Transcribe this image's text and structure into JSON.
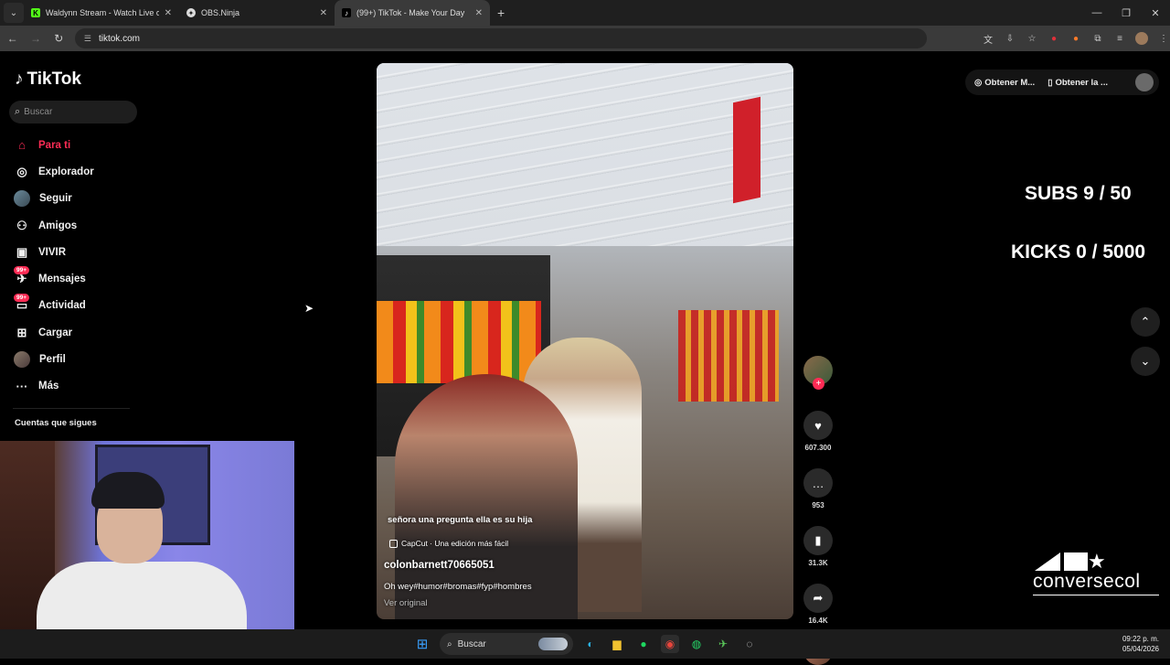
{
  "browser": {
    "tabs": [
      {
        "label": "Waldynn Stream - Watch Live o",
        "icon": "kick-icon",
        "active": false
      },
      {
        "label": "OBS.Ninja",
        "icon": "obs-ninja-icon",
        "active": false
      },
      {
        "label": "(99+) TikTok - Make Your Day",
        "icon": "tiktok-icon",
        "active": true
      }
    ],
    "url": "tiktok.com"
  },
  "sidebar": {
    "logo": "TikTok",
    "search_placeholder": "Buscar",
    "items": [
      {
        "label": "Para ti",
        "icon": "home-icon",
        "active": true
      },
      {
        "label": "Explorador",
        "icon": "compass-icon"
      },
      {
        "label": "Seguir",
        "icon": "avatar-icon"
      },
      {
        "label": "Amigos",
        "icon": "friends-icon"
      },
      {
        "label": "VIVIR",
        "icon": "live-icon"
      },
      {
        "label": "Mensajes",
        "icon": "messages-icon",
        "badge": "99+"
      },
      {
        "label": "Actividad",
        "icon": "activity-icon",
        "badge": "99+"
      },
      {
        "label": "Cargar",
        "icon": "upload-icon"
      },
      {
        "label": "Perfil",
        "icon": "profile-icon"
      },
      {
        "label": "Más",
        "icon": "more-icon"
      }
    ],
    "following_title": "Cuentas que sigues"
  },
  "video": {
    "caption": "señora una pregunta ella es su hija",
    "capcut_label": "CapCut · Una edición más fácil",
    "author": "colonbarnett70665051",
    "description": "Oh wey#humor#bromas#fyp#hombres",
    "see_original": "Ver original"
  },
  "actions": {
    "likes": "607.300",
    "comments": "953",
    "saves": "31.3K",
    "shares": "16.4K"
  },
  "header_right": {
    "get_coins": "Obtener M...",
    "get_app": "Obtener la ..."
  },
  "overlay": {
    "subs": "SUBS 9 / 50",
    "kicks": "KICKS 0 / 5000",
    "brand": "conversecol"
  },
  "taskbar": {
    "search": "Buscar",
    "time": "09:22 p. m.",
    "date": "05/04/2026"
  }
}
